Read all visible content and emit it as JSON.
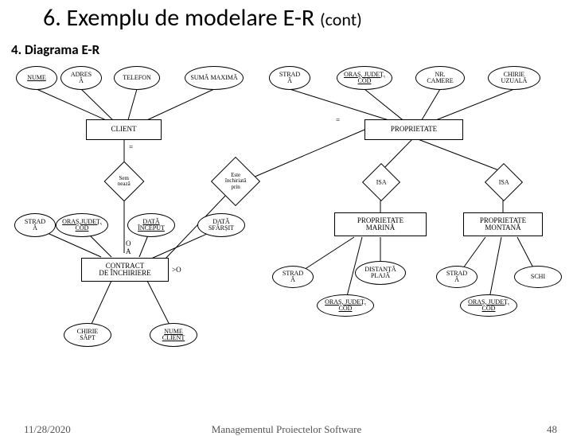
{
  "title_main": "6. Exemplu de modelare E-R",
  "title_cont": "(cont)",
  "subtitle": "4. Diagrama E-R",
  "footer": {
    "date": "11/28/2020",
    "center": "Managementul Proiectelor Software",
    "page": "48"
  },
  "attrs": {
    "nume": "NUME",
    "adresa": "ADRES\nĂ",
    "telefon": "TELEFON",
    "suma_max": "SUMĂ MAXIMĂ",
    "strada1": "STRAD\nĂ",
    "oras_cod1": "ORAȘ, JUDEȚ,\nCOD",
    "nr_camere": "NR.\nCAMERE",
    "chirie_uzuala": "CHIRIE\nUZUALĂ",
    "strada2": "STRAD\nĂ",
    "oras_cod2": "ORAȘ,JUDEȚ,\nCOD",
    "data_inceput": "DATĂ\nÎNCEPUT",
    "data_sfarsit": "DATĂ\nSFÂRȘIT",
    "strada3": "STRAD\nĂ",
    "dist_plaja": "DISTANȚĂ\nPLAJĂ",
    "strada4": "STRAD\nĂ",
    "schi": "SCHI",
    "oras_cod3": "ORAȘ, JUDEȚ,\nCOD",
    "oras_cod4": "ORAȘ, JUDEȚ,\nCOD",
    "chirie_sapt": "CHIRIE\nSĂPT",
    "nume_client": "NUME\nCLIENT"
  },
  "entities": {
    "client": "CLIENT",
    "proprietate": "PROPRIETATE",
    "contract": "CONTRACT\nDE ÎNCHIRIERE",
    "prop_marina": "PROPRIETATE\nMARINĂ",
    "prop_montana": "PROPRIETATE\nMONTANĂ"
  },
  "rels": {
    "semneaza": "Sem\nnează",
    "inchiriata": "Este\nînchiriată\nprin",
    "isa1": "ISA",
    "isa2": "ISA"
  }
}
